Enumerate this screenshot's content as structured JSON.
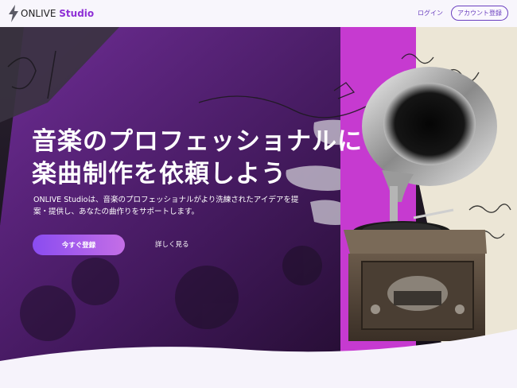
{
  "header": {
    "logo_prefix": "ONLIVE",
    "logo_suffix": "Studio",
    "login_label": "ログイン",
    "signup_label": "アカウント登録"
  },
  "hero": {
    "headline_line1": "音楽のプロフェッショナルに",
    "headline_line2": "楽曲制作を依頼しよう",
    "lead_line1": "ONLIVE Studioは、音楽のプロフェッショナルがより洗練されたアイデアを提",
    "lead_line2": "案・提供し、あなたの曲作りをサポートします。",
    "cta_label": "今すぐ登録",
    "more_label": "詳しく見る"
  },
  "colors": {
    "accent": "#8e2fd6",
    "magenta": "#c63ad0",
    "button_gradient_start": "#8a4cf0",
    "button_gradient_end": "#c46ee6"
  },
  "icons": {
    "logo": "lightning-bolt-icon"
  }
}
